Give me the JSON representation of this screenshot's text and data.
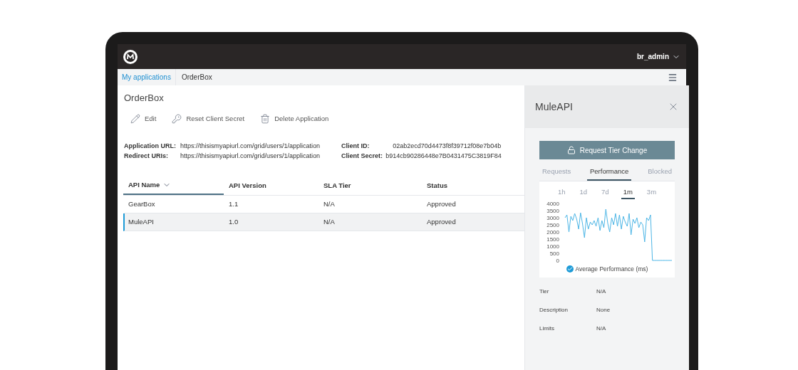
{
  "top_bar": {
    "user_menu": "br_admin"
  },
  "breadcrumb": [
    {
      "label": "My applications",
      "kind": "link"
    },
    {
      "label": "OrderBox",
      "kind": "current"
    }
  ],
  "app": {
    "title": "OrderBox",
    "actions": [
      {
        "label": "Edit",
        "kind": "edit"
      },
      {
        "label": "Reset Client Secret",
        "kind": "key"
      },
      {
        "label": "Delete Application",
        "kind": "delete"
      }
    ],
    "details_left": [
      {
        "label": "Application URL:",
        "value": "https://thisismyapiurl.com/grid/users/1/application"
      },
      {
        "label": "Redirect URIs:",
        "value": "https://thisismyapiurl.com/grid/users/1/application"
      }
    ],
    "details_right": [
      {
        "label": "Client ID:",
        "value": "02ab2ecd70d4473f8f39712f08e7b04b"
      },
      {
        "label": "Client Secret:",
        "value": "b914cb90286448e7B0431475C3819F84"
      }
    ]
  },
  "table": {
    "columns": [
      {
        "label": "API Name",
        "sorted": true
      },
      {
        "label": "API Version",
        "sorted": false
      },
      {
        "label": "SLA Tier",
        "sorted": false
      },
      {
        "label": "Status",
        "sorted": false
      }
    ],
    "rows": [
      {
        "cells": [
          "GearBox",
          "1.1",
          "N/A",
          "Approved"
        ],
        "selected": false
      },
      {
        "cells": [
          "MuleAPI",
          "1.0",
          "N/A",
          "Approved"
        ],
        "selected": true
      }
    ]
  },
  "panel": {
    "title": "MuleAPI",
    "button": "Request Tier Change",
    "tabs": [
      {
        "label": "Requests",
        "selected": false
      },
      {
        "label": "Performance",
        "selected": true
      },
      {
        "label": "Blocked",
        "selected": false
      }
    ],
    "ranges": [
      {
        "label": "1h",
        "selected": false
      },
      {
        "label": "1d",
        "selected": false
      },
      {
        "label": "7d",
        "selected": false
      },
      {
        "label": "1m",
        "selected": true
      },
      {
        "label": "3m",
        "selected": false
      }
    ],
    "chart_data": {
      "type": "line",
      "ylim": [
        0,
        4000
      ],
      "yticks": [
        0,
        500,
        1000,
        1500,
        2000,
        2500,
        3000,
        3500,
        4000
      ],
      "series": [
        {
          "name": "Average Performance (ms)",
          "color": "#4db6e6",
          "values": [
            3000,
            3200,
            2000,
            3100,
            2800,
            3300,
            2900,
            2200,
            3350,
            2600,
            1600,
            3000,
            2200,
            2700,
            2500,
            2800,
            2400,
            3000,
            2100,
            2800,
            2300,
            3600,
            2600,
            2000,
            3000,
            2500,
            3300,
            2400,
            3200,
            2200,
            3100,
            2700,
            2400,
            3300,
            1800,
            2900,
            2600,
            3000,
            2300,
            2700,
            2500,
            1300,
            3000,
            2800,
            3200,
            0,
            0,
            0,
            0,
            0,
            0,
            0,
            0,
            0,
            0,
            0
          ]
        }
      ]
    },
    "legend": {
      "checked": true
    },
    "fields": [
      {
        "label": "Tier",
        "value": "N/A"
      },
      {
        "label": "Description",
        "value": "None"
      },
      {
        "label": "Limits",
        "value": "N/A"
      }
    ]
  }
}
